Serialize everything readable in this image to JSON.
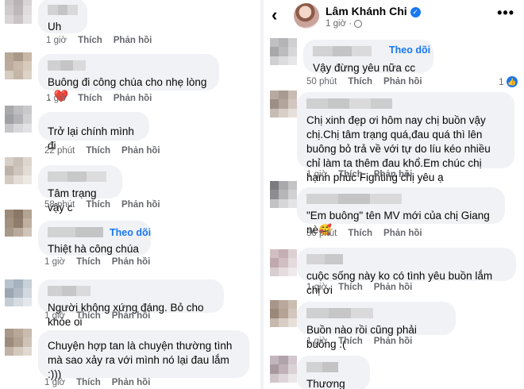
{
  "left": {
    "comments": [
      {
        "text": "Uh",
        "time": "1 giờ",
        "like": "Thích",
        "reply": "Phản hồi"
      },
      {
        "text": "Buông đi công chúa cho nhẹ lòng .",
        "emoji": "❤️",
        "time": "1 giờ",
        "like": "Thích",
        "reply": "Phản hồi"
      },
      {
        "text": "Trở lại chính mình đi",
        "time": "22 phút",
        "like": "Thích",
        "reply": "Phản hồi"
      },
      {
        "text": "Tâm trạng vậy c",
        "time": "58 phút",
        "like": "Thích",
        "reply": "Phản hồi"
      },
      {
        "text": "Thiệt hà công chúa",
        "follow": "Theo dõi",
        "time": "1 giờ",
        "like": "Thích",
        "reply": "Phản hồi"
      },
      {
        "text": "Người không xứng đáng. Bỏ cho khỏe oi",
        "time": "1 giờ",
        "like": "Thích",
        "reply": "Phản hồi"
      },
      {
        "text": "Chuyện hợp tan là chuyện thường tình mà sao xảy ra với mình nó lại đau lắm :)))",
        "time": "1 giờ",
        "like": "Thích",
        "reply": "Phản hồi"
      }
    ]
  },
  "right": {
    "header": {
      "back_icon": "‹",
      "page_name": "Lâm Khánh Chi",
      "verified_icon": "✓",
      "time": "1 giờ",
      "audience_icon": "globe-icon",
      "more": "•••"
    },
    "comments": [
      {
        "text": "Vậy đừng yêu nữa cc",
        "follow": "Theo dõi",
        "time": "50 phút",
        "like": "Thích",
        "reply": "Phản hồi",
        "reaction_count": "1"
      },
      {
        "text": "Chị xinh đẹp ơi hôm nay chị buồn vậy chị.Chị tâm trạng quá,đau quá thì lên buông bỏ trả về với tự do líu kéo nhiều chỉ làm ta thêm đau khổ.Em chúc chị hạnh phúc Fighting chị yêu ạ",
        "time": "1 giờ",
        "like": "Thích",
        "reply": "Phản hồi"
      },
      {
        "text": "\"Em buông\" tên MV mới của chị Giang nè🥰",
        "time": "36 phút",
        "like": "Thích",
        "reply": "Phản hồi"
      },
      {
        "text": "cuộc sống này ko có tình yêu buồn lắm chị ơi",
        "time": "1 giờ",
        "like": "Thích",
        "reply": "Phản hồi"
      },
      {
        "text": "Buồn nào rồi cũng phải buông .(",
        "time": "1 giờ",
        "like": "Thích",
        "reply": "Phản hồi"
      },
      {
        "text": "Thương chị"
      }
    ]
  },
  "colors": {
    "bubble": "#f0f2f5",
    "link": "#1877f2",
    "meta": "#65676b"
  }
}
